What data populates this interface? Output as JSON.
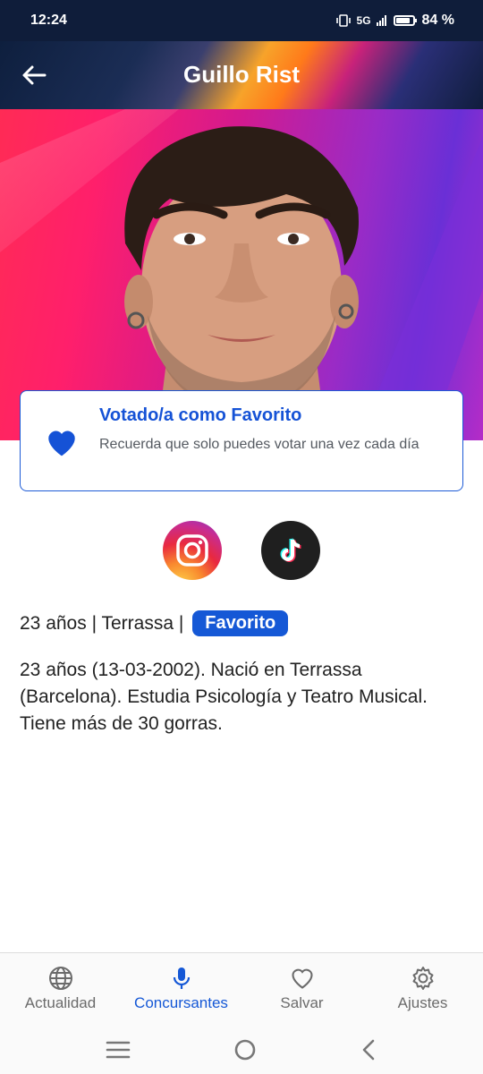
{
  "status_bar": {
    "time": "12:24",
    "network": "5G",
    "battery": "84 %",
    "battery_level": 0.84
  },
  "header": {
    "title": "Guillo Rist",
    "back_icon": "arrow-left-icon"
  },
  "vote_card": {
    "title": "Votado/a como Favorito",
    "text": "Recuerda que solo puedes votar una vez cada día",
    "icon": "heart-icon",
    "accent": "#1552d6"
  },
  "social": [
    {
      "name": "Instagram",
      "icon": "instagram-icon"
    },
    {
      "name": "TikTok",
      "icon": "tiktok-icon"
    }
  ],
  "info": {
    "summary": "23 años | Terrassa |",
    "tag": "Favorito"
  },
  "bio": "23 años (13-03-2002). Nació en Terrassa (Barcelona). Estudia Psicología y Teatro Musical. Tiene más de 30 gorras.",
  "bottom_nav": [
    {
      "label": "Actualidad",
      "icon": "globe-icon",
      "active": false
    },
    {
      "label": "Concursantes",
      "icon": "microphone-icon",
      "active": true
    },
    {
      "label": "Salvar",
      "icon": "heart-outline-icon",
      "active": false
    },
    {
      "label": "Ajustes",
      "icon": "gear-icon",
      "active": false
    }
  ],
  "colors": {
    "primary": "#1558d6",
    "header_bg": "#0f1d3a"
  }
}
